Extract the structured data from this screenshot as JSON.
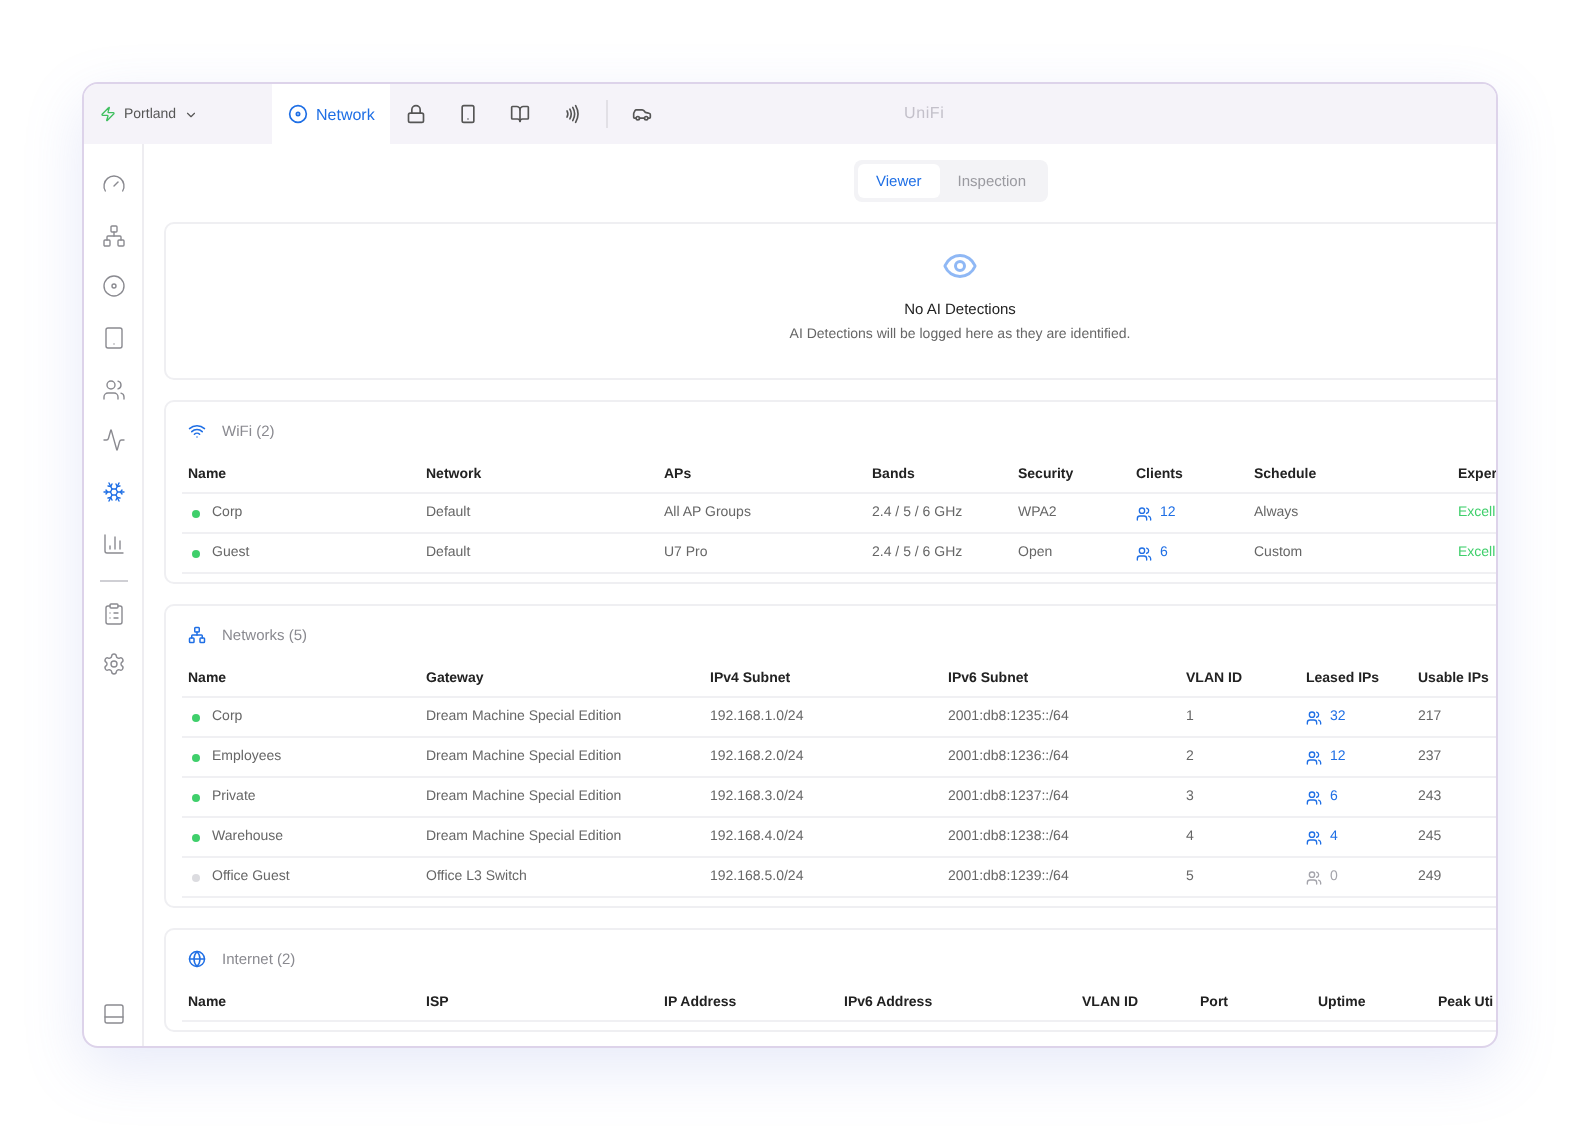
{
  "site": {
    "name": "Portland"
  },
  "apps": [
    {
      "kind": "network",
      "label": "Network",
      "selected": true
    },
    {
      "kind": "protect",
      "selected": false
    },
    {
      "kind": "access",
      "selected": false
    },
    {
      "kind": "talk",
      "selected": false
    },
    {
      "kind": "connect",
      "selected": false
    },
    {
      "kind": "drive",
      "selected": false
    }
  ],
  "brand": "UniFi",
  "sidebar": {
    "groups": [
      {
        "items": [
          {
            "kind": "dashboard",
            "selected": false
          },
          {
            "kind": "topology",
            "selected": false
          },
          {
            "kind": "devices",
            "selected": false
          },
          {
            "kind": "ports",
            "selected": false
          },
          {
            "kind": "clients",
            "selected": false
          },
          {
            "kind": "insights",
            "selected": false
          },
          {
            "kind": "security",
            "selected": true
          },
          {
            "kind": "stats",
            "selected": false
          }
        ]
      },
      {
        "items": [
          {
            "kind": "logs",
            "selected": false
          },
          {
            "kind": "settings",
            "selected": false
          }
        ]
      }
    ],
    "footer": {
      "kind": "collapse"
    }
  },
  "view_switch": [
    {
      "label": "Viewer",
      "selected": true
    },
    {
      "label": "Inspection",
      "selected": false
    }
  ],
  "detections": {
    "title": "No AI Detections",
    "message": "AI Detections will be logged here as they are identified."
  },
  "sections": [
    {
      "kind": "wifi",
      "title": "WiFi (2)",
      "columns": [
        {
          "label": "Name",
          "kind": "name"
        },
        {
          "label": "Network",
          "kind": "text"
        },
        {
          "label": "APs",
          "kind": "text"
        },
        {
          "label": "Bands",
          "kind": "text"
        },
        {
          "label": "Security",
          "kind": "text"
        },
        {
          "label": "Clients",
          "kind": "count"
        },
        {
          "label": "Schedule",
          "kind": "text"
        },
        {
          "label": "Exper",
          "kind": "rating"
        }
      ],
      "rows": [
        {
          "online": true,
          "cells": [
            "Corp",
            "Default",
            "All AP Groups",
            "2.4 / 5 / 6 GHz",
            "WPA2",
            "12",
            "Always",
            "Excell"
          ]
        },
        {
          "online": true,
          "cells": [
            "Guest",
            "Default",
            "U7 Pro",
            "2.4 / 5 / 6 GHz",
            "Open",
            "6",
            "Custom",
            "Excell"
          ]
        }
      ]
    },
    {
      "kind": "networks",
      "title": "Networks (5)",
      "columns": [
        {
          "label": "Name",
          "kind": "name"
        },
        {
          "label": "Gateway",
          "kind": "text"
        },
        {
          "label": "IPv4 Subnet",
          "kind": "text"
        },
        {
          "label": "IPv6 Subnet",
          "kind": "text"
        },
        {
          "label": "VLAN ID",
          "kind": "text"
        },
        {
          "label": "Leased IPs",
          "kind": "count"
        },
        {
          "label": "Usable IPs",
          "kind": "text"
        }
      ],
      "rows": [
        {
          "online": true,
          "cells": [
            "Corp",
            "Dream Machine Special Edition",
            "192.168.1.0/24",
            "2001:db8:1235::/64",
            "1",
            "32",
            "217"
          ]
        },
        {
          "online": true,
          "cells": [
            "Employees",
            "Dream Machine Special Edition",
            "192.168.2.0/24",
            "2001:db8:1236::/64",
            "2",
            "12",
            "237"
          ]
        },
        {
          "online": true,
          "cells": [
            "Private",
            "Dream Machine Special Edition",
            "192.168.3.0/24",
            "2001:db8:1237::/64",
            "3",
            "6",
            "243"
          ]
        },
        {
          "online": true,
          "cells": [
            "Warehouse",
            "Dream Machine Special Edition",
            "192.168.4.0/24",
            "2001:db8:1238::/64",
            "4",
            "4",
            "245"
          ]
        },
        {
          "online": false,
          "cells": [
            "Office Guest",
            "Office L3 Switch",
            "192.168.5.0/24",
            "2001:db8:1239::/64",
            "5",
            "0",
            "249"
          ]
        }
      ]
    },
    {
      "kind": "internet",
      "title": "Internet (2)",
      "columns": [
        {
          "label": "Name"
        },
        {
          "label": "ISP"
        },
        {
          "label": "IP Address"
        },
        {
          "label": "IPv6 Address"
        },
        {
          "label": "VLAN ID"
        },
        {
          "label": "Port"
        },
        {
          "label": "Uptime"
        },
        {
          "label": "Peak Uti"
        }
      ]
    }
  ]
}
